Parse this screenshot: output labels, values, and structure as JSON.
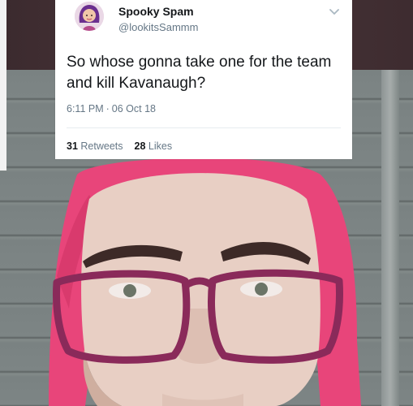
{
  "tweet": {
    "display_name": "Spooky Spam",
    "handle": "@lookitsSammm",
    "text": "So whose gonna take one for the team and kill Kavanaugh?",
    "time": "6:11 PM",
    "separator": "·",
    "date": "06 Oct 18",
    "retweets_count": "31",
    "retweets_label": "Retweets",
    "likes_count": "28",
    "likes_label": "Likes"
  },
  "icons": {
    "avatar": "avatar-bitmoji",
    "menu": "chevron-down-icon"
  },
  "colors": {
    "text_primary": "#14171a",
    "text_secondary": "#657786",
    "hair": "#e8457a",
    "glasses": "#8a2a5a",
    "wall": "#7a8282"
  }
}
